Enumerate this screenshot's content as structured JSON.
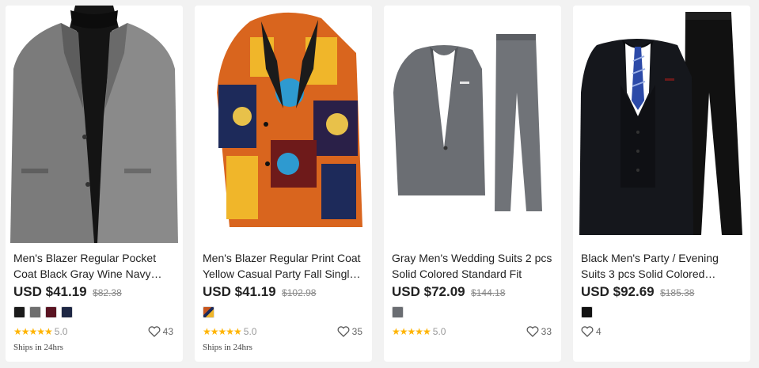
{
  "products": [
    {
      "title": "Men's Blazer Regular Pocket Coat Black Gray Wine Navy Blue",
      "price": "USD $41.19",
      "old_price": "$82.38",
      "swatches": [
        "#1b1b1b",
        "#6f6f6f",
        "#5a1422",
        "#1e2744"
      ],
      "rating": "5.0",
      "likes": "43",
      "ships": "Ships in 24hrs",
      "image_icon": "gray-blazer-image"
    },
    {
      "title": "Men's Blazer Regular Print Coat Yellow Casual Party Fall Single Breasted",
      "price": "USD $41.19",
      "old_price": "$102.98",
      "swatches": [
        "#c8561e"
      ],
      "rating": "5.0",
      "likes": "35",
      "ships": "Ships in 24hrs",
      "image_icon": "print-blazer-image"
    },
    {
      "title": "Gray Men's Wedding Suits 2 pcs Solid Colored Standard Fit",
      "price": "USD $72.09",
      "old_price": "$144.18",
      "swatches": [
        "#6a6d72"
      ],
      "rating": "5.0",
      "likes": "33",
      "ships": "",
      "image_icon": "gray-suit-image"
    },
    {
      "title": "Black Men's Party / Evening Suits 3 pcs Solid Colored Standard Fit",
      "price": "USD $92.69",
      "old_price": "$185.38",
      "swatches": [
        "#121212"
      ],
      "rating": "",
      "likes": "4",
      "ships": "",
      "image_icon": "black-suit-image"
    }
  ],
  "colors": {
    "star": "#ffb400",
    "price": "#222222",
    "old_price": "#888888"
  }
}
